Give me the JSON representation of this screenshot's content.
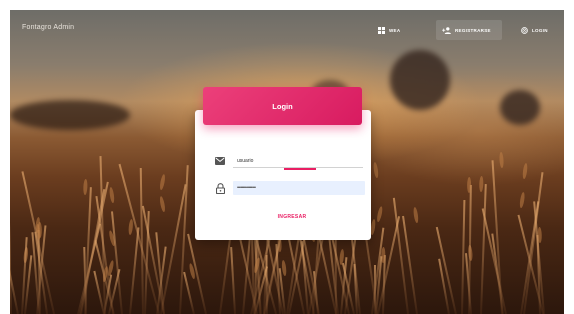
{
  "navbar": {
    "brand": "Fontagro Admin",
    "items": [
      {
        "label": "WEA",
        "icon": "dashboard-icon"
      },
      {
        "label": "REGISTRARSE",
        "icon": "person-add-icon"
      },
      {
        "label": "LOGIN",
        "icon": "fingerprint-icon"
      }
    ]
  },
  "login": {
    "title": "Login",
    "username_value": "usuario",
    "password_value": "••••••••••••••••",
    "submit_label": "INGRESAR"
  },
  "colors": {
    "accent": "#e91e63",
    "autofill": "#e8f0fe"
  }
}
